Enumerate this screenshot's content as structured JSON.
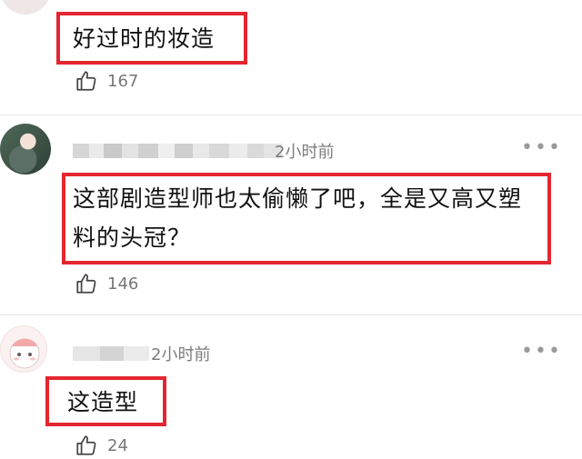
{
  "comments": [
    {
      "text": "好过时的妆造",
      "likes": "167"
    },
    {
      "time": "2小时前",
      "text_line1": "这部剧造型师也太偷懒了吧，全是又高又塑",
      "text_line2": "料的头冠？",
      "likes": "146"
    },
    {
      "time": "2小时前",
      "text": "这造型",
      "likes": "24"
    }
  ],
  "icons": {
    "like": "thumbs-up-icon",
    "more": "more-dots-icon"
  },
  "colors": {
    "highlight_border": "#e3262f",
    "meta_text": "#7d7d7d"
  }
}
